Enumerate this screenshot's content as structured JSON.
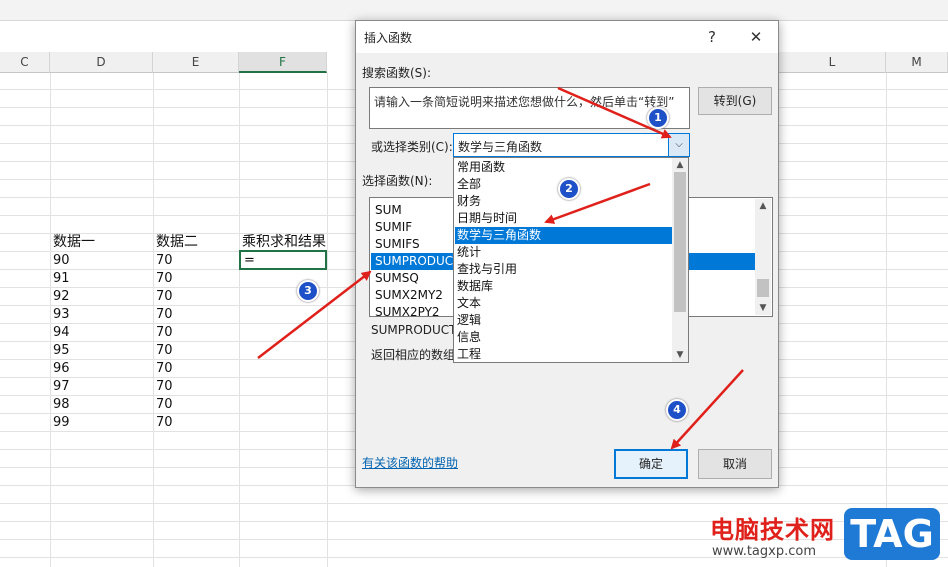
{
  "sheet": {
    "columns": [
      "C",
      "D",
      "E",
      "F",
      "L",
      "M"
    ],
    "headers": {
      "d": "数据一",
      "e": "数据二",
      "f": "乘积求和结果"
    },
    "rows": [
      {
        "d": "90",
        "e": "70"
      },
      {
        "d": "91",
        "e": "70"
      },
      {
        "d": "92",
        "e": "70"
      },
      {
        "d": "93",
        "e": "70"
      },
      {
        "d": "94",
        "e": "70"
      },
      {
        "d": "95",
        "e": "70"
      },
      {
        "d": "96",
        "e": "70"
      },
      {
        "d": "97",
        "e": "70"
      },
      {
        "d": "98",
        "e": "70"
      },
      {
        "d": "99",
        "e": "70"
      }
    ],
    "active_cell_value": "="
  },
  "dialog": {
    "title": "插入函数",
    "help_glyph": "?",
    "close_glyph": "✕",
    "search_label": "搜索函数(S):",
    "search_value": "请输入一条简短说明来描述您想做什么，然后单击“转到”",
    "goto_label": "转到(G)",
    "category_label": "或选择类别(C):",
    "category_value": "数学与三角函数",
    "function_label": "选择函数(N):",
    "functions": [
      "SUM",
      "SUMIF",
      "SUMIFS",
      "SUMPRODUCT",
      "SUMSQ",
      "SUMX2MY2",
      "SUMX2PY2"
    ],
    "selected_function": "SUMPRODUCT",
    "signature_text": "SUMPRODUCT",
    "description_text": "返回相应的数组",
    "help_link": "有关该函数的帮助",
    "ok_label": "确定",
    "cancel_label": "取消"
  },
  "dropdown": {
    "items": [
      "常用函数",
      "全部",
      "财务",
      "日期与时间",
      "数学与三角函数",
      "统计",
      "查找与引用",
      "数据库",
      "文本",
      "逻辑",
      "信息",
      "工程"
    ],
    "selected": "数学与三角函数"
  },
  "annotations": [
    "1",
    "2",
    "3",
    "4"
  ],
  "watermark": {
    "text": "电脑技术网",
    "url": "www.tagxp.com",
    "tag": "TAG"
  },
  "colors": {
    "accent": "#0078d7",
    "excel_green": "#217346",
    "arrow_red": "#e0201a",
    "badge_blue": "#1e50c8"
  }
}
